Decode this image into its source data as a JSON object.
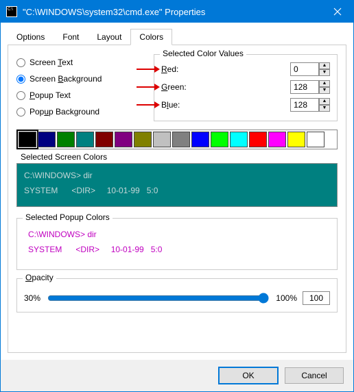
{
  "window": {
    "title": "\"C:\\WINDOWS\\system32\\cmd.exe\" Properties"
  },
  "tabs": [
    "Options",
    "Font",
    "Layout",
    "Colors"
  ],
  "activeTab": "Colors",
  "radios": {
    "screenText": "Screen Text",
    "screenBackground": "Screen Background",
    "popupText": "Popup Text",
    "popupBackground": "Popup Background",
    "selected": "Screen Background"
  },
  "selectedColorValues": {
    "title": "Selected Color Values",
    "red": {
      "label": "Red:",
      "value": "0"
    },
    "green": {
      "label": "Green:",
      "value": "128"
    },
    "blue": {
      "label": "Blue:",
      "value": "128"
    }
  },
  "palette": [
    "#000000",
    "#000080",
    "#008000",
    "#008080",
    "#800000",
    "#800080",
    "#808000",
    "#c0c0c0",
    "#808080",
    "#0000ff",
    "#00ff00",
    "#00ffff",
    "#ff0000",
    "#ff00ff",
    "#ffff00",
    "#ffffff"
  ],
  "paletteSelectedIndex": 0,
  "screenPreview": {
    "caption": "Selected Screen Colors",
    "bg": "#008080",
    "fg": "#c4d7d7",
    "line1": "C:\\WINDOWS> dir",
    "line2": "SYSTEM      <DIR>     10-01-99   5:0"
  },
  "popupPreview": {
    "caption": "Selected Popup Colors",
    "bg": "#ffffff",
    "fg": "#c000c0",
    "line1": "C:\\WINDOWS> dir",
    "line2": "SYSTEM      <DIR>     10-01-99   5:0"
  },
  "opacity": {
    "title": "Opacity",
    "minLabel": "30%",
    "maxLabel": "100%",
    "value": "100"
  },
  "buttons": {
    "ok": "OK",
    "cancel": "Cancel"
  }
}
